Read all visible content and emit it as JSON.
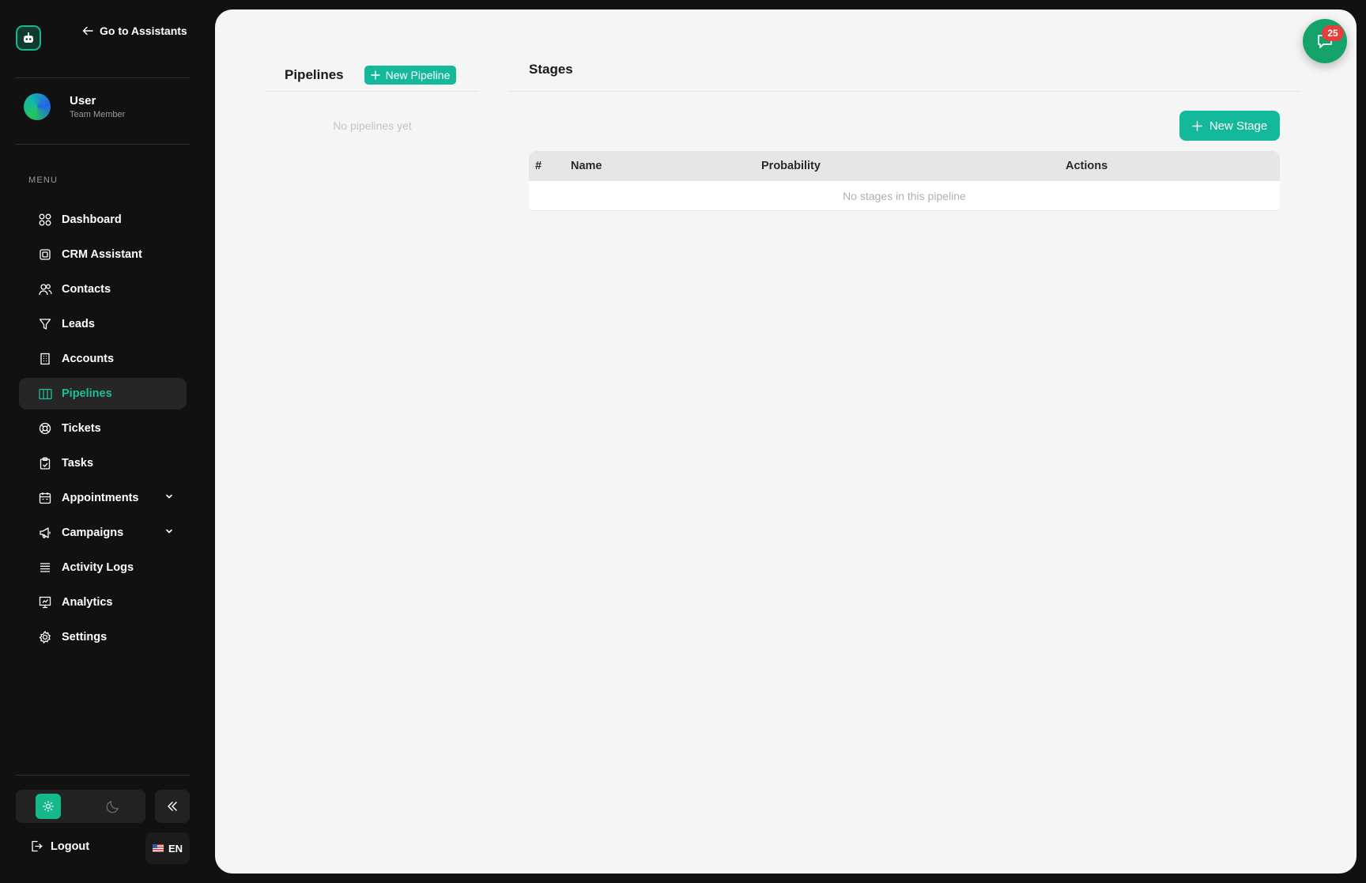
{
  "sidebar": {
    "go_back_label": "Go to Assistants",
    "user": {
      "name": "User",
      "role": "Team Member"
    },
    "menu_label": "MENU",
    "items": [
      {
        "label": "Dashboard",
        "icon": "grid-icon"
      },
      {
        "label": "CRM Assistant",
        "icon": "cpu-icon"
      },
      {
        "label": "Contacts",
        "icon": "users-icon"
      },
      {
        "label": "Leads",
        "icon": "filter-icon"
      },
      {
        "label": "Accounts",
        "icon": "building-icon"
      },
      {
        "label": "Pipelines",
        "icon": "columns-icon",
        "active": true
      },
      {
        "label": "Tickets",
        "icon": "lifebuoy-icon"
      },
      {
        "label": "Tasks",
        "icon": "clipboard-icon"
      },
      {
        "label": "Appointments",
        "icon": "calendar-icon",
        "expandable": true
      },
      {
        "label": "Campaigns",
        "icon": "megaphone-icon",
        "expandable": true
      },
      {
        "label": "Activity Logs",
        "icon": "list-icon"
      },
      {
        "label": "Analytics",
        "icon": "presentation-icon"
      },
      {
        "label": "Settings",
        "icon": "gear-icon"
      }
    ],
    "logout_label": "Logout",
    "language": "EN"
  },
  "pipelines": {
    "title": "Pipelines",
    "new_button": "New Pipeline",
    "empty_text": "No pipelines yet"
  },
  "stages": {
    "title": "Stages",
    "new_button": "New Stage",
    "columns": [
      "#",
      "Name",
      "Probability",
      "Actions"
    ],
    "empty_text": "No stages in this pipeline"
  },
  "chat": {
    "badge_count": "25"
  },
  "colors": {
    "accent": "#14b89a",
    "active_text": "#1dbf97",
    "badge": "#e53e3e",
    "chat_button": "#14a36b"
  }
}
